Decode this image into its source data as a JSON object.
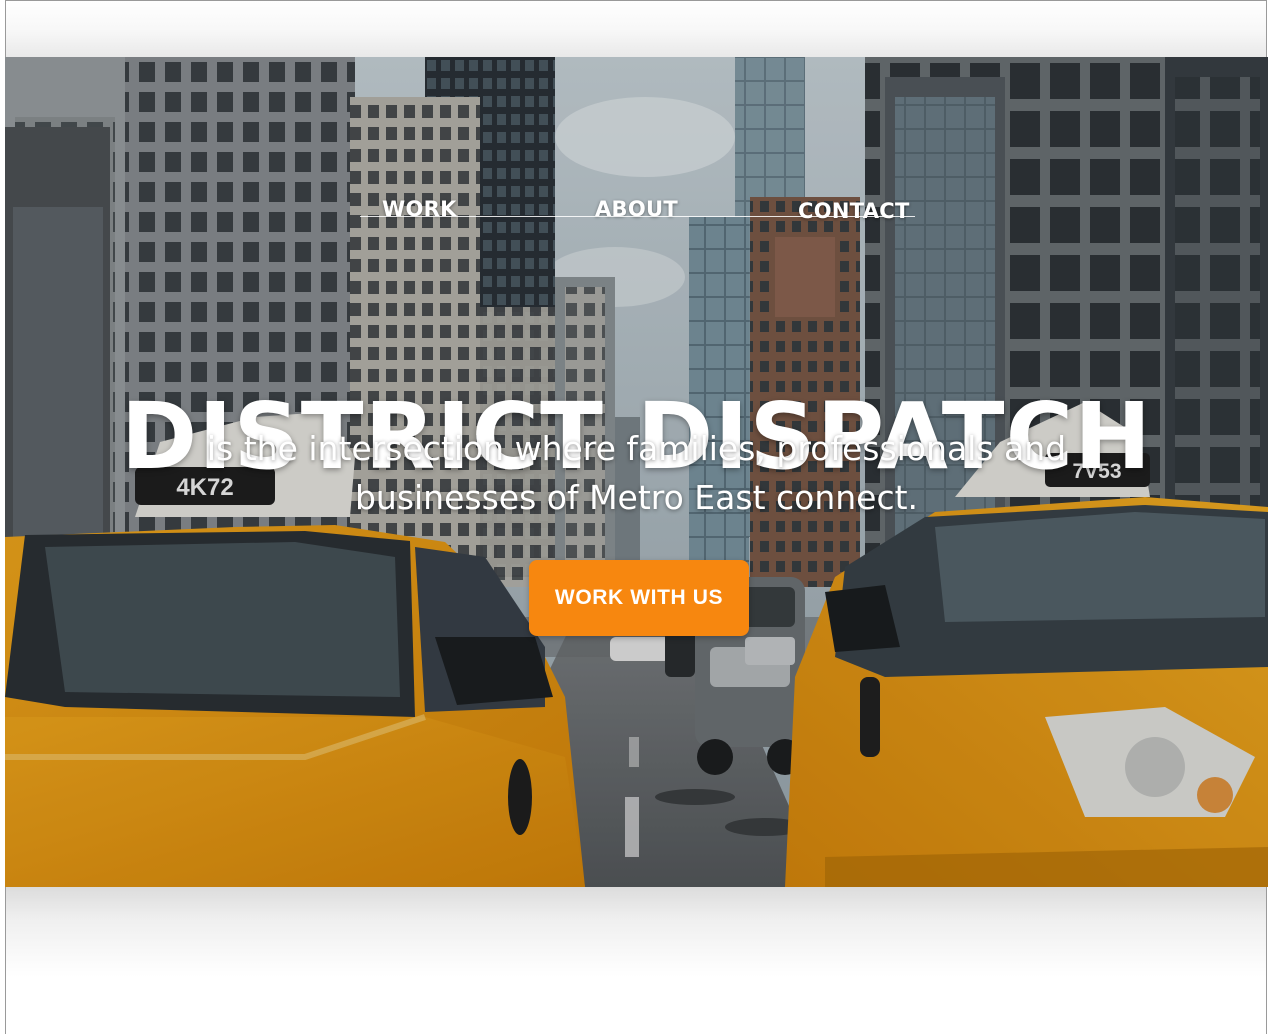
{
  "nav": {
    "items": [
      {
        "label": "WORK"
      },
      {
        "label": "ABOUT"
      },
      {
        "label": "CONTACT"
      }
    ]
  },
  "hero": {
    "title": "DISTRICT DISPATCH",
    "tagline_line1": "is the intersection where families, professionals and",
    "tagline_line2": "businesses of Metro East connect.",
    "cta_label": "WORK WITH US",
    "taxi_left_plate": "4K72",
    "taxi_right_plate": "7V53"
  },
  "colors": {
    "accent": "#f7870f",
    "taxi_yellow": "#f0a820",
    "text": "#ffffff"
  }
}
